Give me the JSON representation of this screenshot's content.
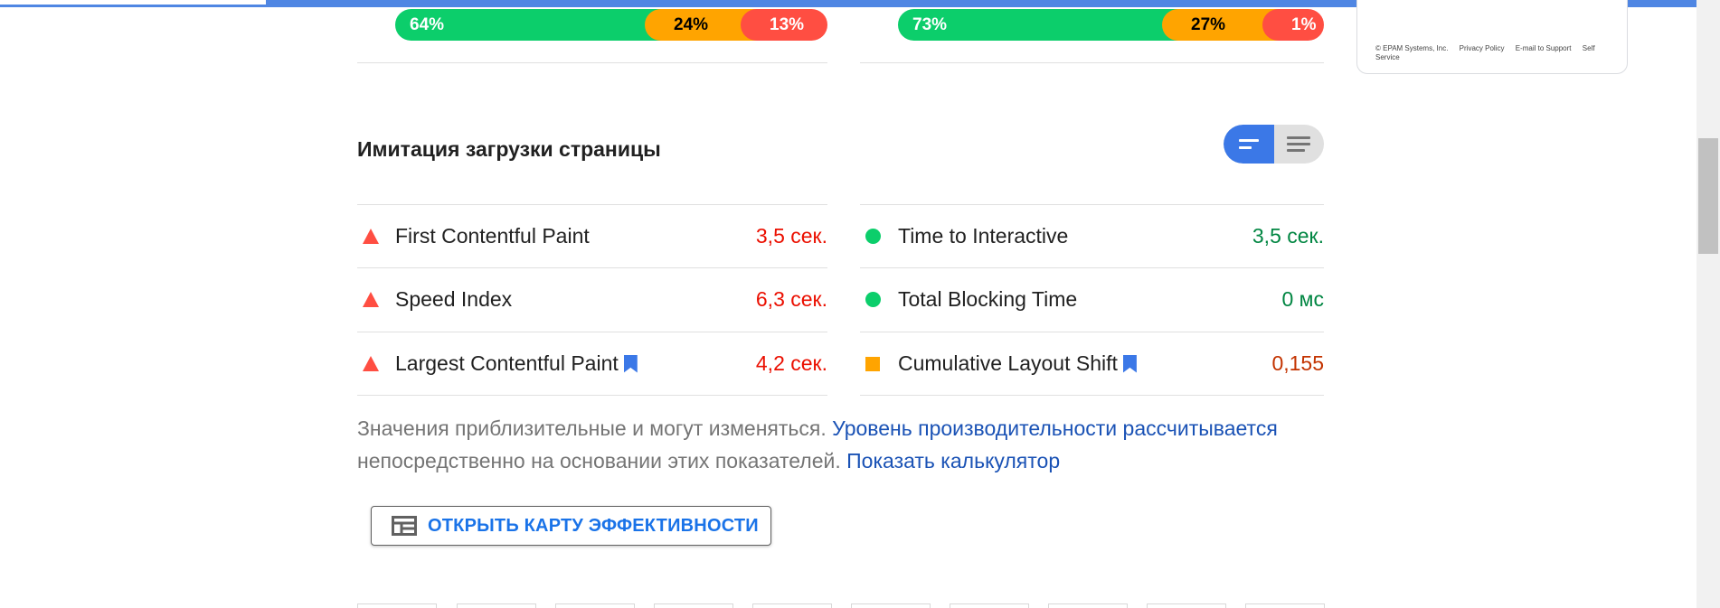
{
  "distribution": {
    "left": {
      "good": "64%",
      "average": "24%",
      "poor": "13%"
    },
    "right": {
      "good": "73%",
      "average": "27%",
      "poor": "1%"
    }
  },
  "side_footer": {
    "copyright": "© EPAM Systems, Inc.",
    "privacy": "Privacy Policy",
    "email_support": "E-mail to Support",
    "self_service": "Self Service"
  },
  "section": {
    "title": "Имитация загрузки страницы"
  },
  "metrics": {
    "fcp": {
      "label": "First Contentful Paint",
      "value": "3,5 сек.",
      "status": "fail"
    },
    "si": {
      "label": "Speed Index",
      "value": "6,3 сек.",
      "status": "fail"
    },
    "lcp": {
      "label": "Largest Contentful Paint",
      "value": "4,2 сек.",
      "status": "fail"
    },
    "tti": {
      "label": "Time to Interactive",
      "value": "3,5 сек.",
      "status": "pass"
    },
    "tbt": {
      "label": "Total Blocking Time",
      "value": "0 мс",
      "status": "pass"
    },
    "cls": {
      "label": "Cumulative Layout Shift",
      "value": "0,155",
      "status": "average"
    }
  },
  "note": {
    "text1": "Значения приблизительные и могут изменяться.",
    "link1": "Уровень производительности рассчитывается",
    "text2": "непосредственно на основании этих показателей.",
    "link2": "Показать калькулятор"
  },
  "treemap": {
    "label": "ОТКРЫТЬ КАРТУ ЭФФЕКТИВНОСТИ"
  },
  "colors": {
    "good": "#0cce6b",
    "average": "#ffa400",
    "poor": "#ff4e42",
    "accent": "#3b78e7",
    "link": "#1a52b5"
  },
  "icons": {
    "fail": "triangle-icon",
    "pass": "circle-icon",
    "average": "square-icon",
    "lcp_badge": "bookmark-icon",
    "toggle_compact": "compact-view-icon",
    "toggle_expanded": "expanded-view-icon",
    "treemap": "treemap-icon"
  }
}
